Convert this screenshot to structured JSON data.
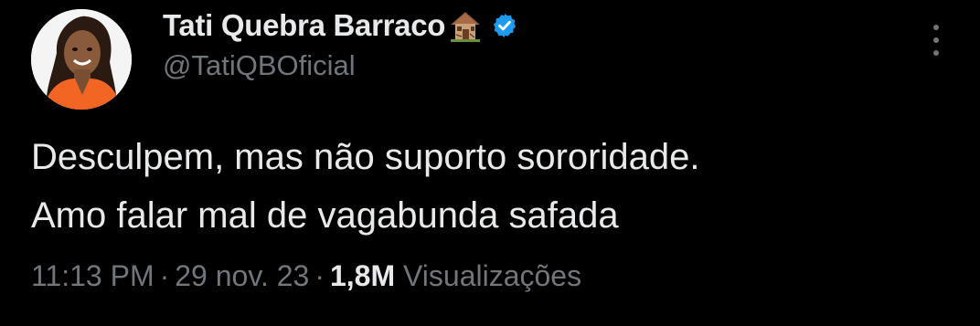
{
  "author": {
    "display_name": "Tati Quebra Barraco",
    "handle": "@TatiQBOficial",
    "name_emoji": "house-icon",
    "verified": true,
    "verified_color": "#1d9bf0"
  },
  "tweet": {
    "lines": [
      "Desculpem, mas não suporto sororidade.",
      "Amo falar mal de vagabunda safada"
    ]
  },
  "meta": {
    "time": "11:13 PM",
    "separator": "·",
    "date": "29 nov. 23",
    "views_count": "1,8M",
    "views_label": "Visualizações"
  },
  "colors": {
    "background": "#000000",
    "primary_text": "#e7e9ea",
    "secondary_text": "#71767b",
    "accent": "#1d9bf0",
    "avatar_outfit": "#f26522"
  }
}
